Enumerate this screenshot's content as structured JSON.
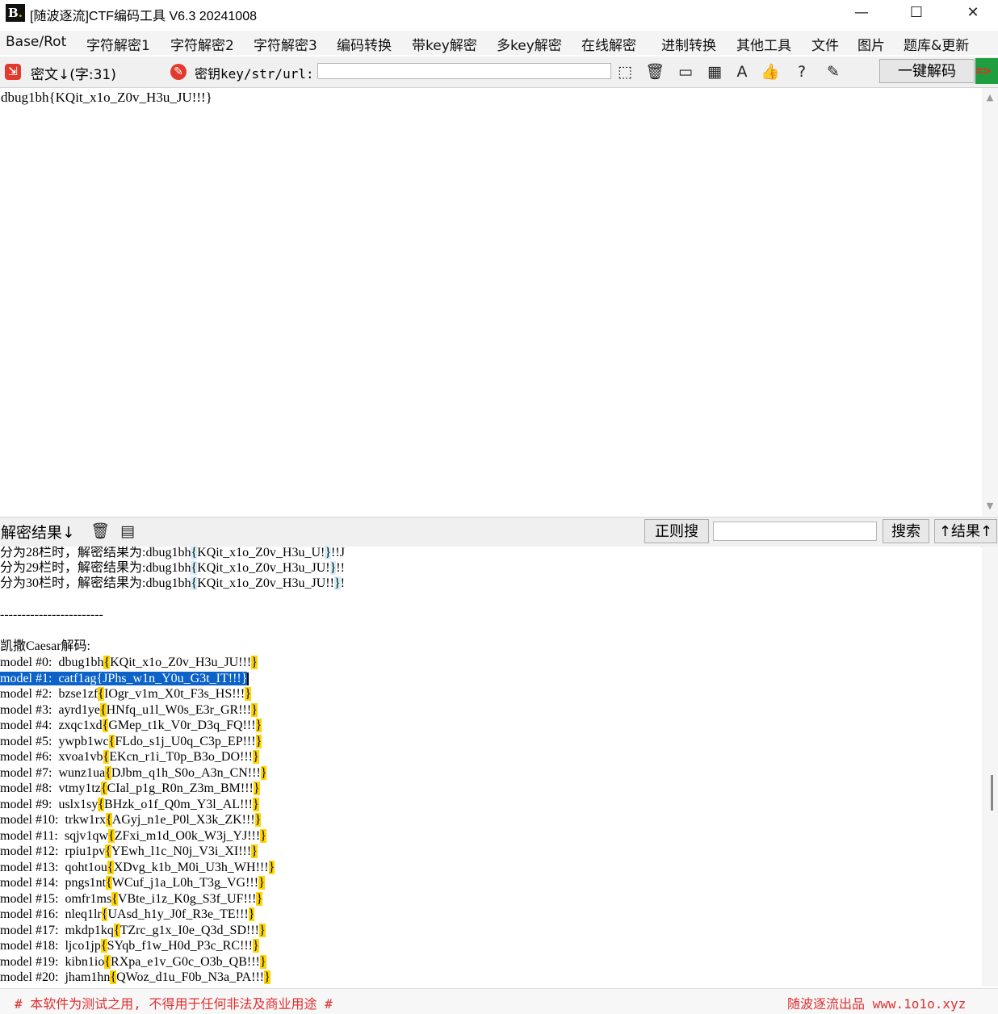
{
  "window": {
    "title": "[随波逐流]CTF编码工具 V6.3 20241008",
    "minimize": "—",
    "maximize": "☐",
    "close": "✕"
  },
  "menu": [
    "Base/Rot",
    "字符解密1",
    "字符解密2",
    "字符解密3",
    "编码转换",
    "带key解密",
    "多key解密",
    "在线解密",
    "进制转换",
    "其他工具",
    "文件",
    "图片",
    "题库&更新"
  ],
  "toolbar": {
    "cipher_label": "密文↓(字:31)",
    "key_label": "密钥key/str/url:",
    "key_value": "",
    "decode_button": "一键解码",
    "icons": [
      "select-icon",
      "trash-icon",
      "terminal-icon",
      "calculator-icon",
      "font-icon",
      "thumbs-up-icon",
      "help-icon",
      "edit-icon"
    ]
  },
  "cipher_text": "dbug1bh{KQit_x1o_Z0v_H3u_JU!!!}",
  "result_header": {
    "label": "解密结果↓",
    "regex_button": "正则搜",
    "search_value": "",
    "search_button": "搜索",
    "up_button": "↑结果↑"
  },
  "results": {
    "rail_lines": [
      {
        "prefix": "分为28栏时，解密结果为:",
        "text": "dbug1bh",
        "b1": "{",
        "body": "KQit_x1o_Z0v_H3u_U!",
        "b2": "}",
        "tail": "!!J"
      },
      {
        "prefix": "分为29栏时，解密结果为:",
        "text": "dbug1bh",
        "b1": "{",
        "body": "KQit_x1o_Z0v_H3u_JU!",
        "b2": "}",
        "tail": "!!"
      },
      {
        "prefix": "分为30栏时，解密结果为:",
        "text": "dbug1bh",
        "b1": "{",
        "body": "KQit_x1o_Z0v_H3u_JU!!",
        "b2": "}",
        "tail": "!"
      }
    ],
    "separator": "------------------------",
    "caesar_title": "凯撒Caesar解码:",
    "caesar_lines": [
      {
        "label": "model #0:  ",
        "word": "dbug1bh",
        "body": "KQit_x1o_Z0v_H3u_JU!!!"
      },
      {
        "label": "model #1:  ",
        "word": "catf1ag",
        "body": "JPhs_w1n_Y0u_G3t_IT!!!"
      },
      {
        "label": "model #2:  ",
        "word": "bzse1zf",
        "body": "IOgr_v1m_X0t_F3s_HS!!!"
      },
      {
        "label": "model #3:  ",
        "word": "ayrd1ye",
        "body": "HNfq_u1l_W0s_E3r_GR!!!"
      },
      {
        "label": "model #4:  ",
        "word": "zxqc1xd",
        "body": "GMep_t1k_V0r_D3q_FQ!!!"
      },
      {
        "label": "model #5:  ",
        "word": "ywpb1wc",
        "body": "FLdo_s1j_U0q_C3p_EP!!!"
      },
      {
        "label": "model #6:  ",
        "word": "xvoa1vb",
        "body": "EKcn_r1i_T0p_B3o_DO!!!"
      },
      {
        "label": "model #7:  ",
        "word": "wunz1ua",
        "body": "DJbm_q1h_S0o_A3n_CN!!!"
      },
      {
        "label": "model #8:  ",
        "word": "vtmy1tz",
        "body": "CIal_p1g_R0n_Z3m_BM!!!"
      },
      {
        "label": "model #9:  ",
        "word": "uslx1sy",
        "body": "BHzk_o1f_Q0m_Y3l_AL!!!"
      },
      {
        "label": "model #10:  ",
        "word": "trkw1rx",
        "body": "AGyj_n1e_P0l_X3k_ZK!!!"
      },
      {
        "label": "model #11:  ",
        "word": "sqjv1qw",
        "body": "ZFxi_m1d_O0k_W3j_YJ!!!"
      },
      {
        "label": "model #12:  ",
        "word": "rpiu1pv",
        "body": "YEwh_l1c_N0j_V3i_XI!!!"
      },
      {
        "label": "model #13:  ",
        "word": "qoht1ou",
        "body": "XDvg_k1b_M0i_U3h_WH!!!"
      },
      {
        "label": "model #14:  ",
        "word": "pngs1nt",
        "body": "WCuf_j1a_L0h_T3g_VG!!!"
      },
      {
        "label": "model #15:  ",
        "word": "omfr1ms",
        "body": "VBte_i1z_K0g_S3f_UF!!!"
      },
      {
        "label": "model #16:  ",
        "word": "nleq1lr",
        "body": "UAsd_h1y_J0f_R3e_TE!!!"
      },
      {
        "label": "model #17:  ",
        "word": "mkdp1kq",
        "body": "TZrc_g1x_I0e_Q3d_SD!!!"
      },
      {
        "label": "model #18:  ",
        "word": "ljco1jp",
        "body": "SYqb_f1w_H0d_P3c_RC!!!"
      },
      {
        "label": "model #19:  ",
        "word": "kibn1io",
        "body": "RXpa_e1v_G0c_O3b_QB!!!"
      },
      {
        "label": "model #20:  ",
        "word": "jham1hn",
        "body": "QWoz_d1u_F0b_N3a_PA!!!"
      }
    ]
  },
  "footer": {
    "left": "# 本软件为测试之用, 不得用于任何非法及商业用途 #",
    "right": "随波逐流出品 www.1o1o.xyz"
  },
  "colors": {
    "highlight_yellow": "#ffd400",
    "highlight_blue": "#d4eefa",
    "selection": "#0b63c9",
    "footer_text": "#e03030",
    "brand_red": "#e23b2e"
  }
}
